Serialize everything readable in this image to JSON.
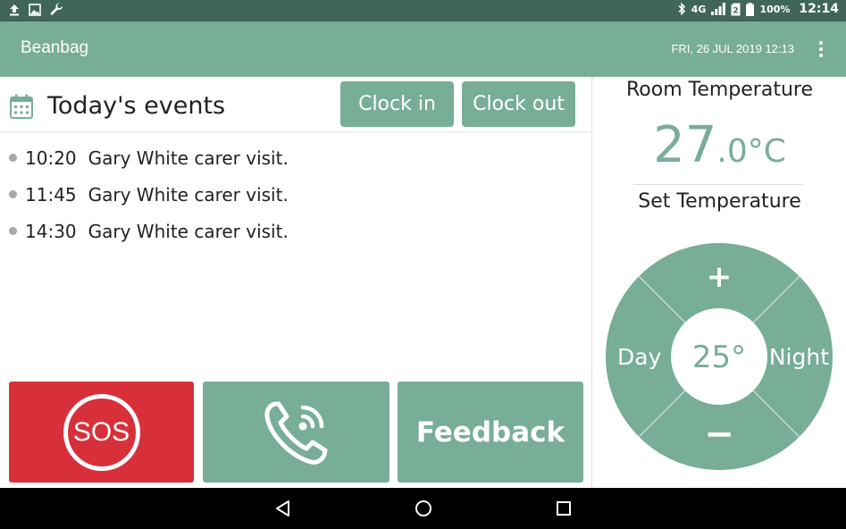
{
  "status_bar": {
    "network": "4G",
    "battery_percent": "100%",
    "time": "12:14"
  },
  "app_bar": {
    "title": "Beanbag",
    "datetime": "FRI, 26 JUL 2019 12:13"
  },
  "events": {
    "title": "Today's events",
    "clock_in_label": "Clock in",
    "clock_out_label": "Clock out",
    "items": [
      {
        "time": "10:20",
        "text": "Gary White carer visit."
      },
      {
        "time": "11:45",
        "text": "Gary White carer visit."
      },
      {
        "time": "14:30",
        "text": "Gary White carer visit."
      }
    ]
  },
  "actions": {
    "sos_label": "SOS",
    "feedback_label": "Feedback"
  },
  "thermostat": {
    "room_label": "Room Temperature",
    "room_value_int": "27",
    "room_value_dec": ".0°C",
    "set_label": "Set Temperature",
    "set_value": "25°",
    "plus_label": "+",
    "minus_label": "−",
    "day_label": "Day",
    "night_label": "Night"
  },
  "colors": {
    "accent": "#78ad98",
    "status_bar": "#3f6659",
    "sos": "#d8303a"
  }
}
